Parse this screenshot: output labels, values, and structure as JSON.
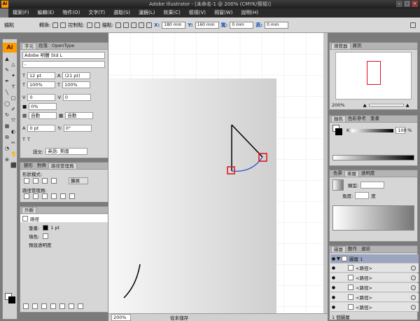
{
  "window": {
    "title": "Adobe Illustrator - [未命名-1 @ 200% (CMYK/預視)]",
    "app_icon": "Ai"
  },
  "menu": [
    "檔案(F)",
    "編輯(E)",
    "物件(O)",
    "文字(T)",
    "選取(S)",
    "濾鏡(L)",
    "效果(C)",
    "檢視(V)",
    "視窗(W)",
    "說明(H)"
  ],
  "control": {
    "tool_label": "錨點",
    "convert_label": "轉換:",
    "handles_label": "控制點:",
    "anchor_label": "錨點:",
    "x_label": "X:",
    "x_value": "180 mm",
    "y_label": "Y:",
    "y_value": "160 mm",
    "w_label": "寬:",
    "w_value": "0 mm",
    "h_label": "高:",
    "h_value": "0 mm"
  },
  "character": {
    "tabs": [
      "字元",
      "段落",
      "OpenType"
    ],
    "font": "Adobe 明體 Std L",
    "style": "-",
    "size": "12 pt",
    "leading": "(21 pt)",
    "hscale": "100%",
    "vscale": "100%",
    "kerning": "0",
    "tracking": "0",
    "tsume": "0%",
    "aki_left": "自動",
    "aki_right": "自動",
    "baseline": "0 pt",
    "rotation": "0°",
    "language_label": "語文:",
    "language": "英語: 美國"
  },
  "pathfinder": {
    "tabs": [
      "變形",
      "對齊",
      "路徑管理員"
    ],
    "shape_modes": "形狀模式:",
    "expand": "擴展",
    "pathfinders": "路徑管理員:"
  },
  "appearance": {
    "tab": "外觀",
    "target": "路徑",
    "stroke_label": "筆畫:",
    "stroke_value": "1 pt",
    "fill_label": "填色:",
    "opacity": "預設透明度"
  },
  "navigator": {
    "tabs": [
      "導覽器",
      "資訊"
    ],
    "zoom": "200%"
  },
  "color": {
    "tabs": [
      "顏色",
      "色彩參考",
      "筆畫"
    ],
    "channel": "K",
    "value": "100",
    "unit": "%"
  },
  "gradient": {
    "tabs": [
      "色票",
      "漸層",
      "透明度"
    ],
    "type_label": "類型:",
    "angle_label": "角度:",
    "degree": "度"
  },
  "layers": {
    "tabs": [
      "圖層",
      "動作",
      "連結"
    ],
    "layer_name": "圖層 1",
    "items": [
      "<路徑>",
      "<路徑>",
      "<路徑>",
      "<路徑>",
      "<路徑>"
    ],
    "count": "1 個圖層"
  },
  "status": {
    "zoom": "200%",
    "state": "從未儲存"
  }
}
